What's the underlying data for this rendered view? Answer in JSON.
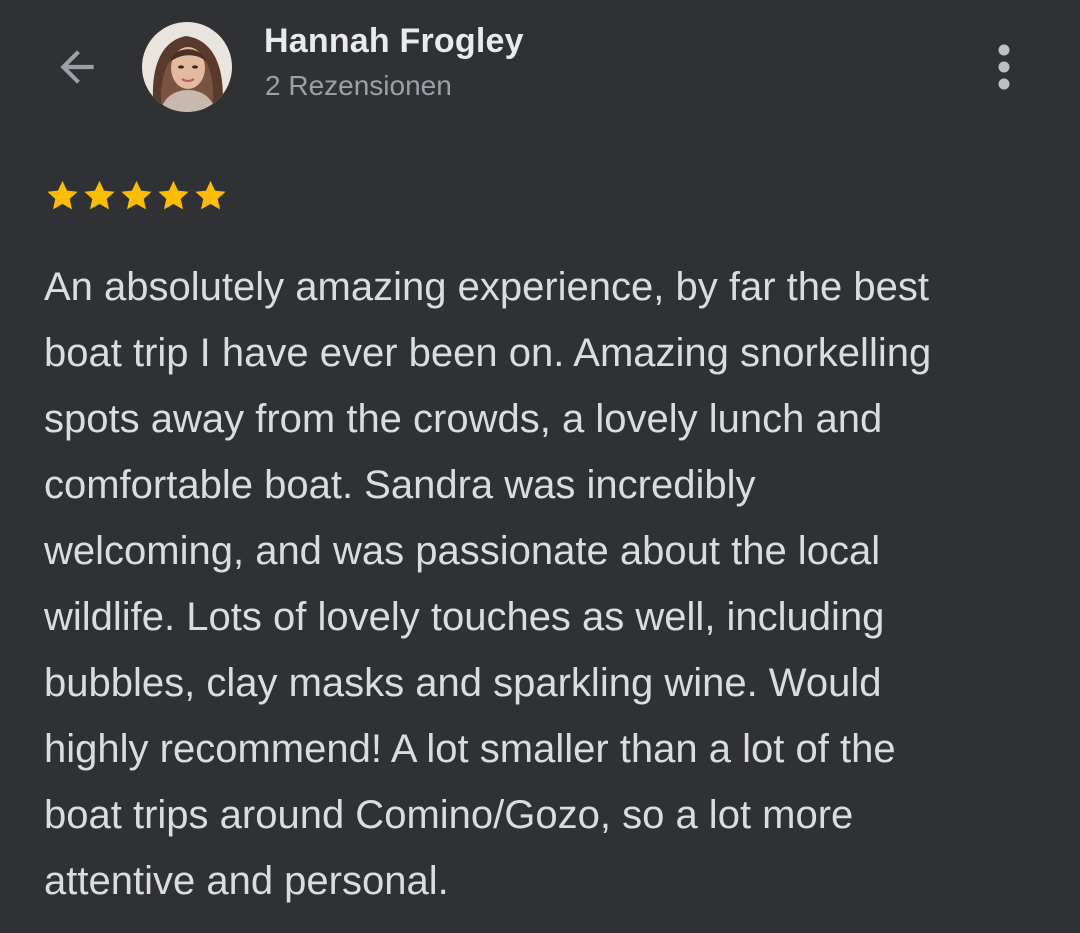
{
  "header": {
    "back_icon": "arrow-back-icon",
    "reviewer_name": "Hannah Frogley",
    "review_count": "2 Rezensionen",
    "menu_icon": "more-vert-icon"
  },
  "review": {
    "rating": 5,
    "rating_max": 5,
    "star_color": "#fbbc04",
    "text": "An absolutely amazing experience, by far the best\nboat trip I have ever been on. Amazing snorkelling\nspots away from the crowds, a lovely lunch and\ncomfortable boat. Sandra was incredibly\nwelcoming, and was passionate about the local\nwildlife. Lots of lovely touches as well, including\nbubbles, clay masks and sparkling wine. Would\nhighly recommend! A lot smaller than a lot of the\nboat trips around Comino/Gozo, so a lot more\nattentive and personal."
  },
  "colors": {
    "background": "#303134",
    "primary_text": "#e8eaed",
    "secondary_text": "#9aa0a6"
  }
}
